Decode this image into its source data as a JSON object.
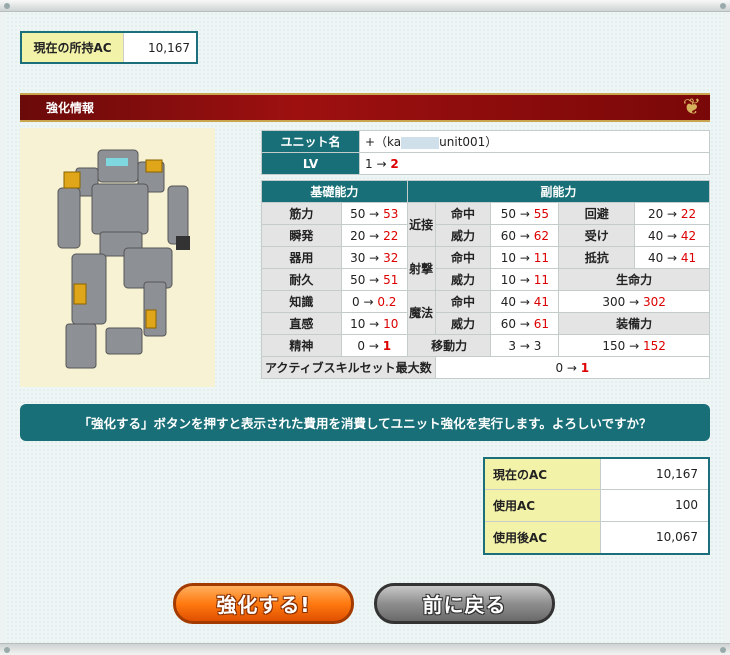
{
  "ac": {
    "label": "現在の所持AC",
    "value": "10,167"
  },
  "section_title": "強化情報",
  "unit": {
    "name_label": "ユニット名",
    "name_prefix": "+（ka",
    "name_suffix": "unit001）",
    "lv_label": "LV",
    "lv_from": "1 →",
    "lv_to": "2"
  },
  "headers": {
    "basic": "基礎能力",
    "sub": "副能力"
  },
  "basic": [
    {
      "label": "筋力",
      "from": "50 →",
      "to": "53"
    },
    {
      "label": "瞬発",
      "from": "20 →",
      "to": "22"
    },
    {
      "label": "器用",
      "from": "30 →",
      "to": "32"
    },
    {
      "label": "耐久",
      "from": "50 →",
      "to": "51"
    },
    {
      "label": "知識",
      "from": "0 →",
      "to": "0.2"
    },
    {
      "label": "直感",
      "from": "10 →",
      "to": "10"
    },
    {
      "label": "精神",
      "from": "0 →",
      "to": "1"
    }
  ],
  "sub": {
    "melee_label": "近接",
    "shoot_label": "射撃",
    "magic_label": "魔法",
    "hit": "命中",
    "power": "威力",
    "melee_hit": {
      "from": "50 →",
      "to": "55"
    },
    "melee_power": {
      "from": "60 →",
      "to": "62"
    },
    "shoot_hit": {
      "from": "10 →",
      "to": "11"
    },
    "shoot_power": {
      "from": "10 →",
      "to": "11"
    },
    "magic_hit": {
      "from": "40 →",
      "to": "41"
    },
    "magic_power": {
      "from": "60 →",
      "to": "61"
    },
    "move_label": "移動力",
    "move": "3 → 3",
    "evade_label": "回避",
    "evade": {
      "from": "20 →",
      "to": "22"
    },
    "guard_label": "受け",
    "guard": {
      "from": "40 →",
      "to": "42"
    },
    "resist_label": "抵抗",
    "resist": {
      "from": "40 →",
      "to": "41"
    },
    "life_label": "生命力",
    "life": {
      "from": "300 →",
      "to": "302"
    },
    "equip_label": "装備力",
    "equip": {
      "from": "150 →",
      "to": "152"
    }
  },
  "active_skill": {
    "label": "アクティブスキルセット最大数",
    "from": "0 →",
    "to": "1"
  },
  "message": "「強化する」ボタンを押すと表示された費用を消費してユニット強化を実行します。よろしいですか？",
  "summary": [
    {
      "label": "現在のAC",
      "value": "10,167"
    },
    {
      "label": "使用AC",
      "value": "100"
    },
    {
      "label": "使用後AC",
      "value": "10,067"
    }
  ],
  "buttons": {
    "enhance": "強化する!",
    "back": "前に戻る"
  }
}
